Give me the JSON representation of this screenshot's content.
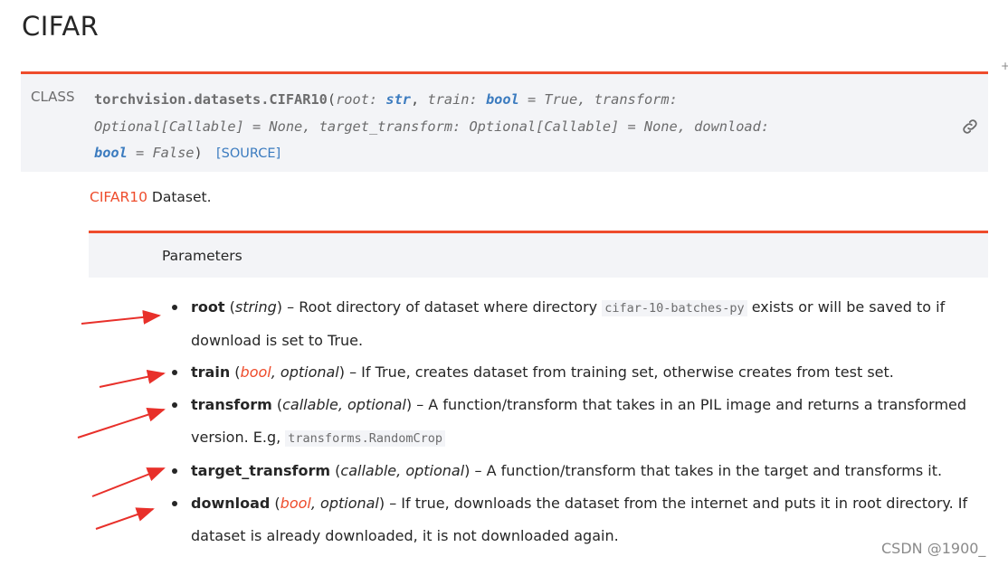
{
  "page": {
    "title": "CIFAR",
    "plus": "+"
  },
  "signature": {
    "label": "CLASS",
    "name": "torchvision.datasets.CIFAR10",
    "open": "(",
    "close": ")",
    "p1_name": "root:",
    "p1_type": "str",
    "p2_name": "train:",
    "p2_type": "bool",
    "p2_default": " = True,",
    "p3_name": "transform:",
    "p3_type": "Optional[Callable]",
    "p3_default": " = None,",
    "p4_name": "target_transform:",
    "p4_type": "Optional[Callable]",
    "p4_default": " = None,",
    "p5_name": "download:",
    "p5_type": "bool",
    "p5_default": " = False",
    "comma": ",",
    "source": "[SOURCE]"
  },
  "description": {
    "ref": "CIFAR10",
    "text": " Dataset."
  },
  "params": {
    "label": "Parameters",
    "items": [
      {
        "name": "root",
        "open": " (",
        "type": "string",
        "close": ")",
        "text": " – Root directory of dataset where directory ",
        "code": "cifar-10-batches-py",
        "text2": " exists or will be saved to if download is set to True."
      },
      {
        "name": "train",
        "open": " (",
        "type": "bool",
        "sep": ", ",
        "opt": "optional",
        "close": ")",
        "text": " – If True, creates dataset from training set, otherwise creates from test set."
      },
      {
        "name": "transform",
        "open": " (",
        "type": "callable",
        "sep": ", ",
        "opt": "optional",
        "close": ")",
        "text": " – A function/transform that takes in an PIL image and returns a transformed version. E.g, ",
        "code": "transforms.RandomCrop"
      },
      {
        "name": "target_transform",
        "open": " (",
        "type": "callable",
        "sep": ", ",
        "opt": "optional",
        "close": ")",
        "text": " – A function/transform that takes in the target and transforms it."
      },
      {
        "name": "download",
        "open": " (",
        "type": "bool",
        "sep": ", ",
        "opt": "optional",
        "close": ")",
        "text": " – If true, downloads the dataset from the internet and puts it in root directory. If dataset is already downloaded, it is not downloaded again."
      }
    ]
  },
  "watermark": "CSDN @1900_",
  "colors": {
    "accent": "#ee4c2c",
    "link": "#3b7bbf",
    "panel": "#f3f4f7"
  }
}
